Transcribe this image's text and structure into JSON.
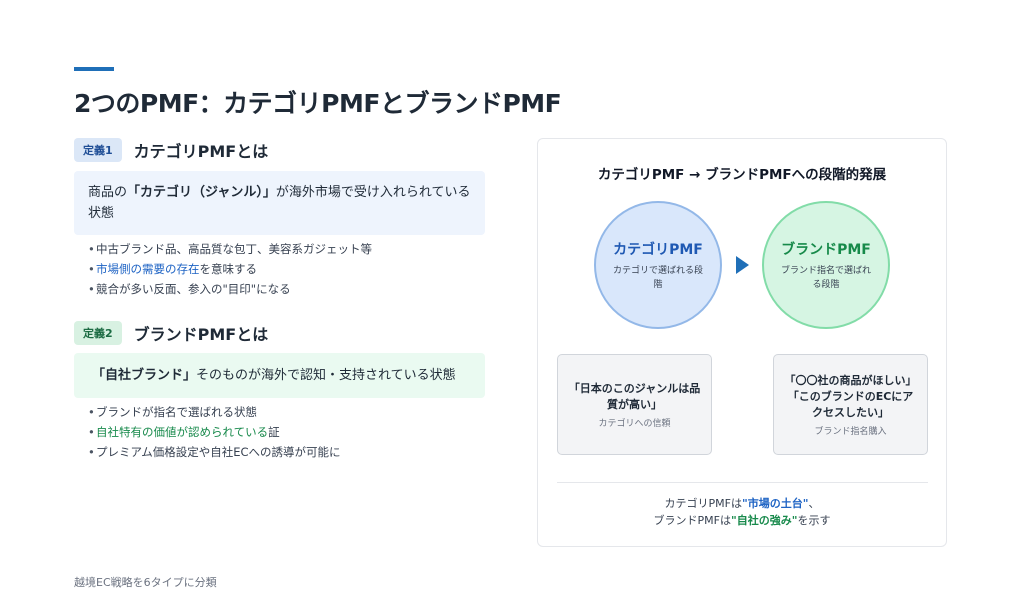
{
  "page": {
    "title": "2つのPMF：カテゴリPMFとブランドPMF",
    "footer": "越境EC戦略を6タイプに分類"
  },
  "colors": {
    "accent": "#1f6fb8",
    "blue": "#1e63c4",
    "green": "#188a4c"
  },
  "definitions": [
    {
      "badge": "定義1",
      "title": "カテゴリPMFとは",
      "box": {
        "prefix": "商品の",
        "emphasis": "「カテゴリ（ジャンル）」",
        "suffix": "が海外市場で受け入れられている状態"
      },
      "bullets": [
        {
          "text": "中古ブランド品、高品質な包丁、美容系ガジェット等"
        },
        {
          "highlight": "市場側の需要の存在",
          "rest": "を意味する"
        },
        {
          "text": "競合が多い反面、参入の\"目印\"になる"
        }
      ]
    },
    {
      "badge": "定義2",
      "title": "ブランドPMFとは",
      "box": {
        "emphasis": "「自社ブランド」",
        "suffix": "そのものが海外で認知・支持されている状態"
      },
      "bullets": [
        {
          "text": "ブランドが指名で選ばれる状態"
        },
        {
          "highlight": "自社特有の価値が認められている",
          "rest": "証"
        },
        {
          "text": "プレミアム価格設定や自社ECへの誘導が可能に"
        }
      ]
    }
  ],
  "diagram": {
    "title": "カテゴリPMF → ブランドPMFへの段階的発展",
    "stages": [
      {
        "title": "カテゴリPMF",
        "subtitle": "カテゴリで選ばれる段階"
      },
      {
        "title": "ブランドPMF",
        "subtitle": "ブランド指名で選ばれる段階"
      }
    ],
    "quotes": [
      {
        "text": "「日本のこのジャンルは品質が高い」",
        "caption": "カテゴリへの信頼"
      },
      {
        "text": "「〇〇社の商品がほしい」\n「このブランドのECにアクセスしたい」",
        "caption": "ブランド指名購入"
      }
    ],
    "summary": {
      "line1_prefix": "カテゴリPMFは",
      "line1_emphasis": "\"市場の土台\"",
      "line1_suffix": "、",
      "line2_prefix": "ブランドPMFは",
      "line2_emphasis": "\"自社の強み\"",
      "line2_suffix": "を示す"
    }
  }
}
